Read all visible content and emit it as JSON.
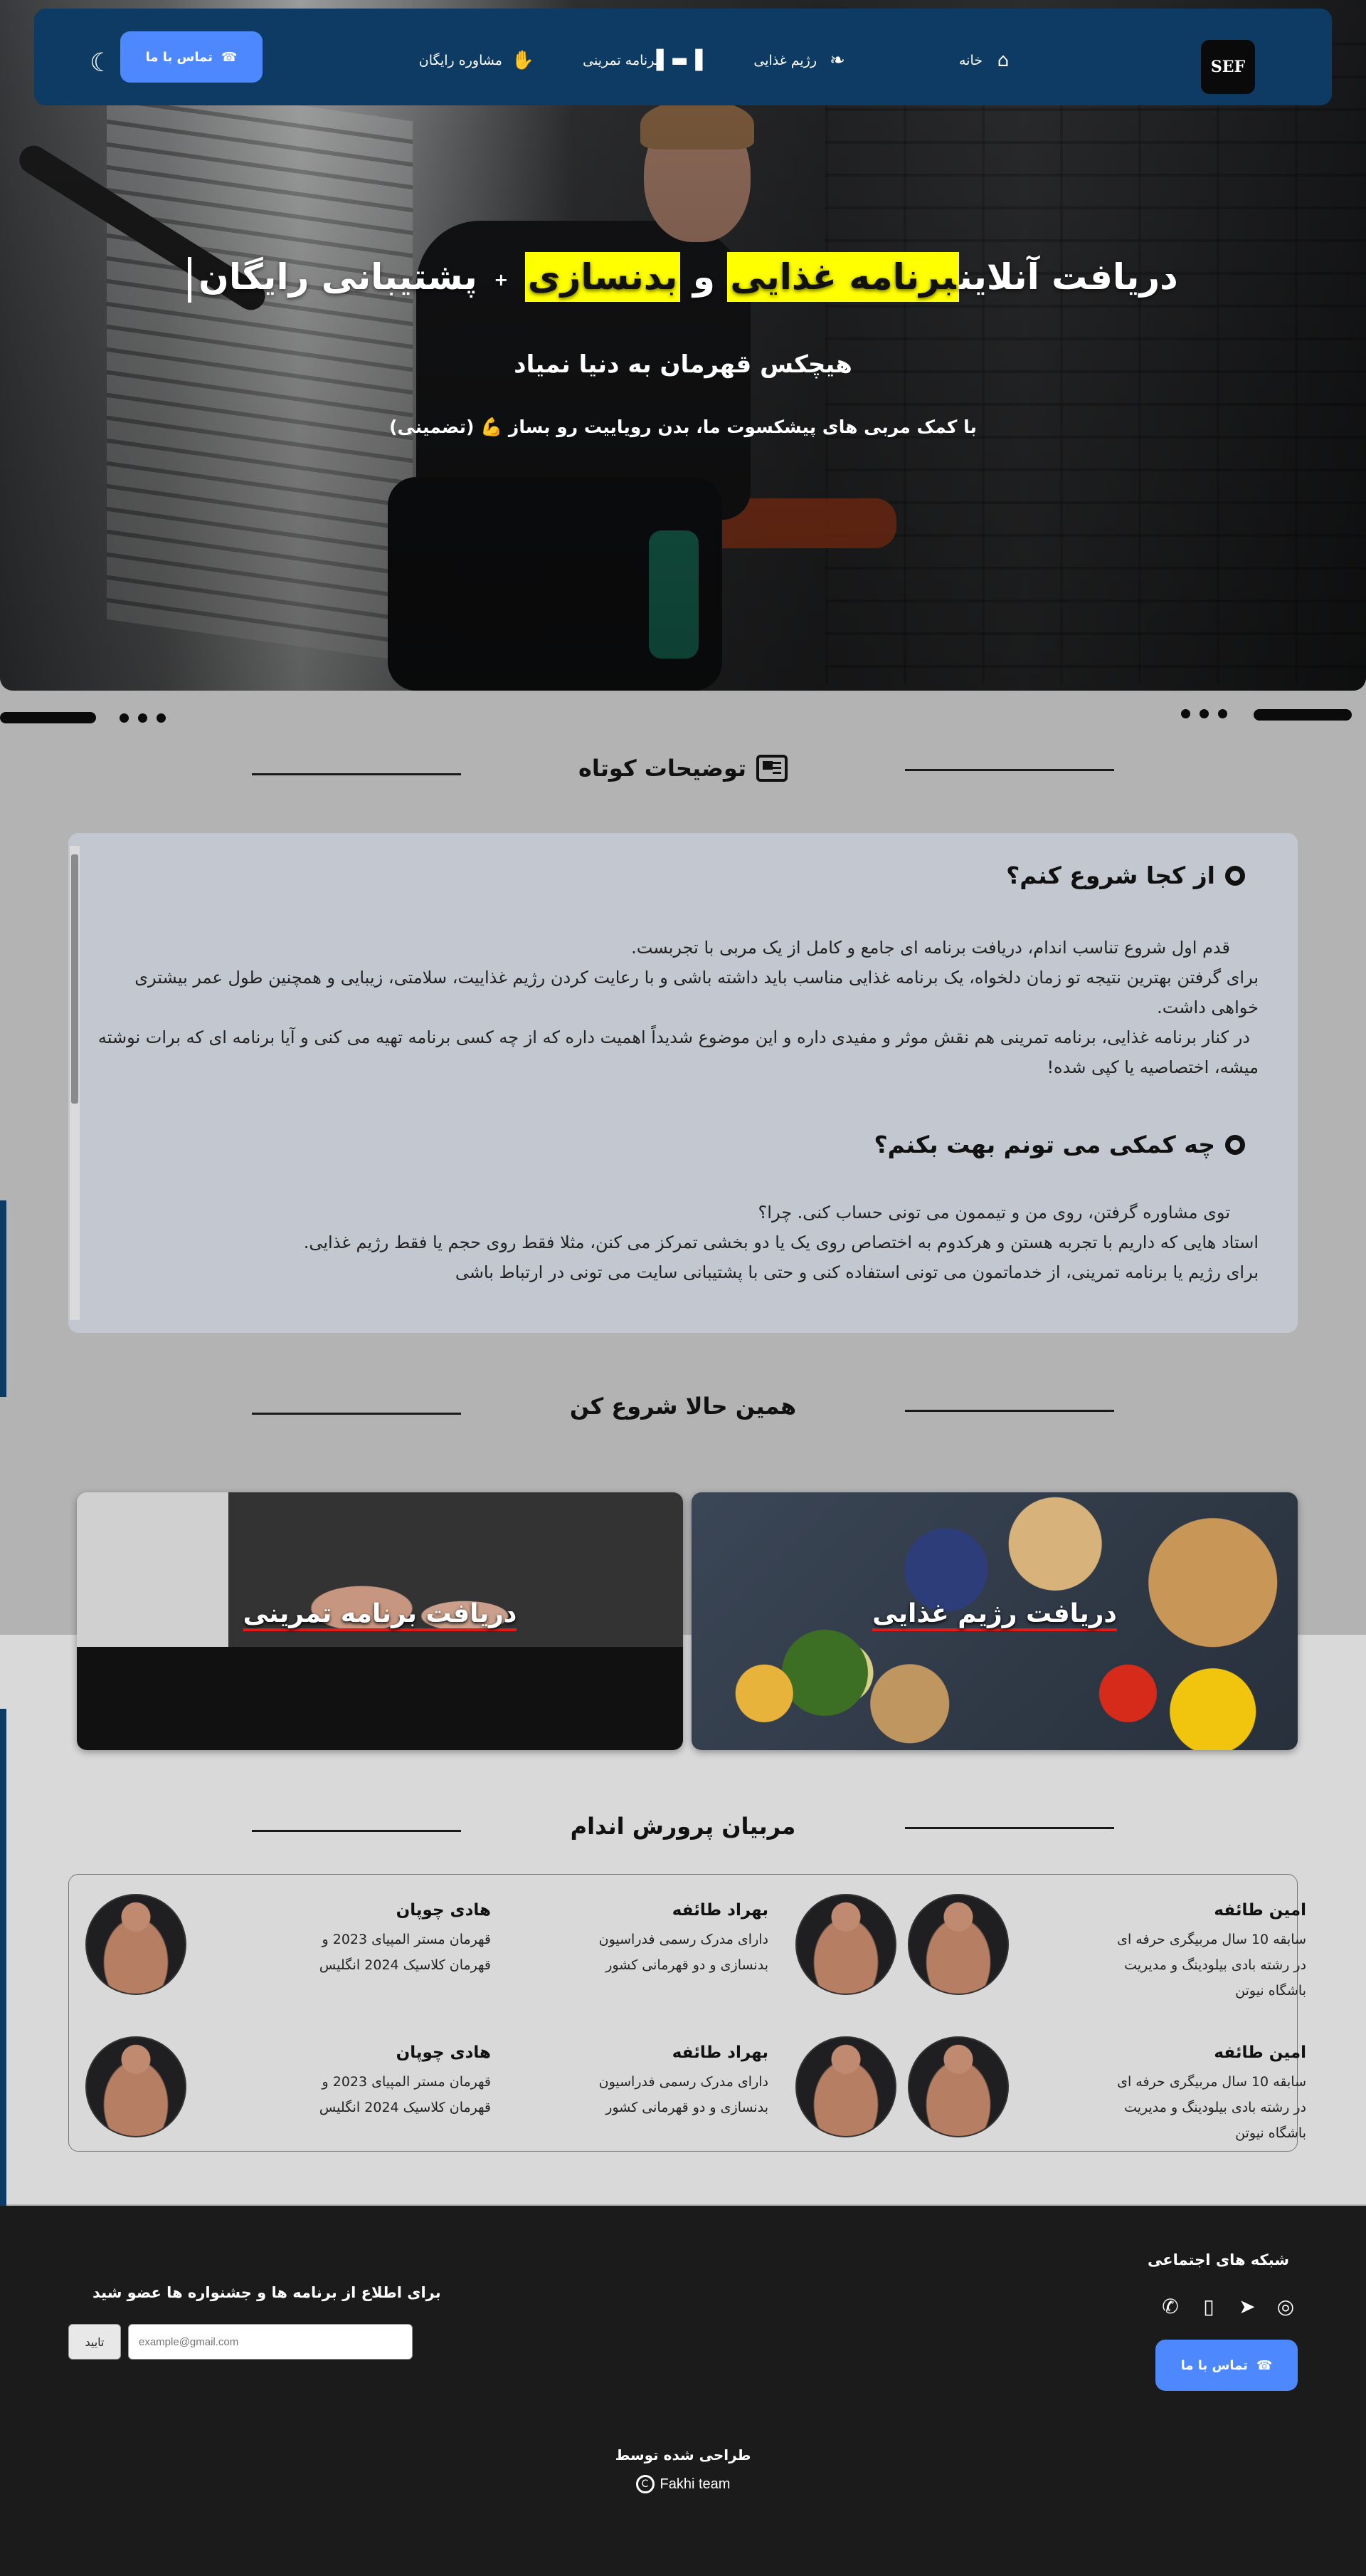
{
  "header": {
    "logo_text": "SEF",
    "nav": [
      {
        "label": "خانه",
        "icon": "home-icon"
      },
      {
        "label": "رژیم غذایی",
        "icon": "leaf-icon"
      },
      {
        "label": "برنامه تمرینی",
        "icon": "dumbbell-icon"
      },
      {
        "label": "مشاوره رایگان",
        "icon": "handshake-icon"
      }
    ],
    "contact_label": "تماس با ما",
    "theme_icon": "moon-icon"
  },
  "hero": {
    "title_part1": "دریافت آنلاین",
    "title_highlight1": "برنامه غذایی",
    "title_and": "و",
    "title_highlight2": "بدنسازی",
    "title_plus": "+",
    "title_part2": "پشتیبانی رایگان",
    "subtitle": "هیچکس قهرمان به دنیا نمیاد",
    "tagline": "با کمک مربی های پیشکسوت ما، بدن رویاییت رو بساز 💪 (تضمینی)"
  },
  "description": {
    "section_title": "توضیحات کوتاه",
    "q1": "از کجا شروع کنم؟",
    "q1_lines": [
      "قدم اول شروع تناسب اندام، دریافت برنامه ای جامع و کامل از یک مربی با تجربست.",
      "برای گرفتن بهترین نتیجه تو زمان دلخواه، یک برنامه غذایی مناسب باید داشته باشی و با رعایت کردن رژیم غذاییت، سلامتی، زیبایی و همچنین طول عمر بیشتری",
      "خواهی داشت.",
      "در کنار برنامه غذایی، برنامه تمرینی هم نقش موثر و مفیدی داره و این موضوع شدیداً اهمیت داره که از چه کسی برنامه تهیه می کنی و آیا برنامه ای که برات نوشته",
      "میشه، اختصاصیه یا کپی شده!"
    ],
    "q2": "چه کمکی می تونم بهت بکنم؟",
    "q2_lines": [
      "توی مشاوره گرفتن، روی من و تیممون می تونی حساب کنی. چرا؟",
      "استاد هایی که داریم با تجربه هستن و هرکدوم به اختصاص روی یک یا دو بخشی تمرکز می کنن، مثلا فقط روی حجم یا فقط رژیم غذایی.",
      "برای رژیم یا برنامه تمرینی، از خدماتمون می تونی استفاده کنی و حتی با پشتیبانی سایت می تونی در ارتباط باشی"
    ]
  },
  "start": {
    "section_title": "همین حالا شروع کن",
    "card_diet": "دریافت رژیم غذایی",
    "card_workout": "دریافت برنامه تمرینی"
  },
  "coaches": {
    "section_title": "مربیان پرورش اندام",
    "items": [
      {
        "name": "امین طائفه",
        "bio": "سابقه 10 سال مربیگری حرفه ای در رشته بادی بیلودینگ و مدیریت باشگاه نیوتن"
      },
      {
        "name": "بهراد طائفه",
        "bio": "دارای مدرک رسمی فدراسیون بدنسازی و دو قهرمانی کشور"
      },
      {
        "name": "هادی چوپان",
        "bio": "قهرمان مستر المپیای 2023 و قهرمان کلاسیک 2024 انگلیس"
      },
      {
        "name": "امین طائفه",
        "bio": "سابقه 10 سال مربیگری حرفه ای در رشته بادی بیلودینگ و مدیریت باشگاه نیوتن"
      },
      {
        "name": "بهراد طائفه",
        "bio": "دارای مدرک رسمی فدراسیون بدنسازی و دو قهرمانی کشور"
      },
      {
        "name": "هادی چوپان",
        "bio": "قهرمان مستر المپیای 2023 و قهرمان کلاسیک 2024 انگلیس"
      }
    ]
  },
  "footer": {
    "social_title": "شبکه های اجتماعی",
    "social_icons": [
      "instagram-icon",
      "telegram-icon",
      "phone-icon",
      "whatsapp-icon"
    ],
    "contact_label": "تماس با ما",
    "newsletter_label": "برای اطلاع از برنامه ها و جشنواره ها عضو شید",
    "email_placeholder": "example@gmail.com",
    "submit_label": "تایید",
    "designed_by": "طراحی شده توسط",
    "team": "Fakhi team"
  }
}
